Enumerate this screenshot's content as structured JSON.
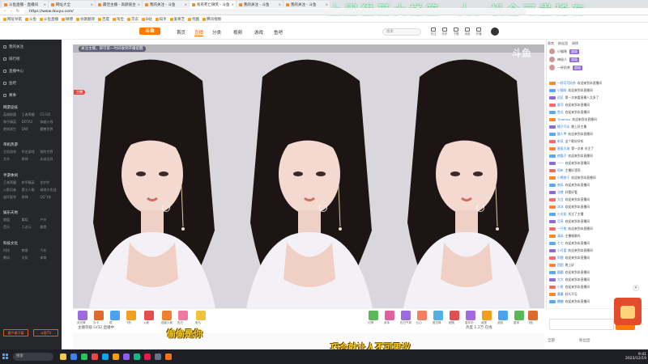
{
  "browser": {
    "tabs": [
      {
        "label": "斗鱼直播 - 直播间"
      },
      {
        "label": "网址大全"
      },
      {
        "label": "最佳主播 - 高颜值主播"
      },
      {
        "label": "我的关注 - 斗鱼"
      },
      {
        "label": "有有死亡微笑 - 斗鱼"
      },
      {
        "label": "我的关注 - 斗鱼"
      },
      {
        "label": "我的关注 - 斗鱼"
      }
    ],
    "url": "https://www.douyu.com/",
    "bookmarks": [
      "网址导航",
      "斗鱼",
      "斗鱼直播",
      "微博",
      "谷歌翻译",
      "百度",
      "淘宝",
      "京东",
      "B站",
      "知乎",
      "爱奇艺",
      "优酷",
      "腾讯视频"
    ]
  },
  "overlay_title": "上周猫耳大楼第一人，机会可贵稀有",
  "site": {
    "logo": "斗鱼",
    "nav": [
      {
        "label": "首页",
        "active": false
      },
      {
        "label": "直播",
        "active": true
      },
      {
        "label": "分类",
        "active": false
      },
      {
        "label": "视频",
        "active": false
      },
      {
        "label": "游戏",
        "active": false
      },
      {
        "label": "鱼吧",
        "active": false
      }
    ],
    "search_placeholder": "搜索",
    "header_icons": [
      "关注",
      "历史",
      "下载",
      "消息",
      "开播"
    ]
  },
  "sidebar": {
    "top_items": [
      "我的关注",
      "排行榜",
      "直播中心",
      "鱼吧",
      "赛事"
    ],
    "sections": [
      {
        "title": "网游竞技",
        "items": [
          "英雄联盟",
          "王者荣耀",
          "CS:GO",
          "和平精英",
          "DOTA2",
          "穿越火线",
          "绝地求生",
          "DNF",
          "魔兽世界"
        ]
      },
      {
        "title": "单机热游",
        "items": [
          "主机游戏",
          "怀旧游戏",
          "我的世界",
          "方舟",
          "原神",
          "永劫无间"
        ]
      },
      {
        "title": "手游休闲",
        "items": [
          "王者荣耀",
          "和平精英",
          "金铲铲",
          "火影忍者",
          "第五人格",
          "球球大作战",
          "崩坏星穹",
          "原神",
          "QQ飞车"
        ]
      },
      {
        "title": "娱乐天地",
        "items": [
          "颜值",
          "舞蹈",
          "户外",
          "音乐",
          "二次元",
          "美食"
        ]
      },
      {
        "title": "科技文化",
        "items": [
          "科技",
          "教育",
          "汽车",
          "数码",
          "文化",
          "体育"
        ]
      }
    ],
    "buttons": [
      "客户端下载",
      "斗鱼TV"
    ]
  },
  "player": {
    "notice": "关注主播，即可第一时间收到开播提醒",
    "watermark": "斗鱼",
    "tag": "主播",
    "subtitle_left": "偷偷是你",
    "subtitle_right": "巧合就让人不可思议"
  },
  "giftbar": {
    "gifts": [
      "荧光棒",
      "办卡",
      "稳",
      "飞机",
      "火箭",
      "超级火箭",
      "告白",
      "鱼丸",
      "灯牌",
      "亲亲",
      "告白气球",
      "比心",
      "魔法棒",
      "超跑",
      "嘉年华",
      "城堡",
      "游艇",
      "星球",
      "飞船"
    ],
    "room_meta": "主播等级 LV32 直播中",
    "room_meta2": "热度 1.2万  在线"
  },
  "chat": {
    "rank_tabs": [
      "贵宾",
      "粉丝团",
      "周榜"
    ],
    "rank": [
      {
        "name": "小猫咪",
        "badge": "超级"
      },
      {
        "name": "神秘人",
        "badge": "超级"
      },
      {
        "name": "一杯奶茶",
        "badge": "超级"
      }
    ],
    "messages": [
      {
        "badge_color": "#ff8a2b",
        "user": "一杯可可奶茶",
        "text": "欢迎来到本直播间"
      },
      {
        "badge_color": "#5aa9ff",
        "user": "小猫呀",
        "text": "欢迎来到本直播间"
      },
      {
        "badge_color": "#8e6ad6",
        "user": "初见",
        "text": "第一次来看直播人太多了"
      },
      {
        "badge_color": "#ff6a6a",
        "user": "星河",
        "text": "欢迎来到本直播间"
      },
      {
        "badge_color": "#5aa9ff",
        "user": "鱼丸",
        "text": "欢迎来到本直播间"
      },
      {
        "badge_color": "#ff8a2b",
        "user": "Tiramisu",
        "text": "欢迎来到本直播间"
      },
      {
        "badge_color": "#8e6ad6",
        "user": "橘子汽水",
        "text": "晚上好主播"
      },
      {
        "badge_color": "#5aa9ff",
        "user": "路人甲",
        "text": "欢迎来到本直播间"
      },
      {
        "badge_color": "#ff6a6a",
        "user": "听风",
        "text": "这个歌好好听"
      },
      {
        "badge_color": "#ff8a2b",
        "user": "星辰大海",
        "text": "第一次来 关注了"
      },
      {
        "badge_color": "#5aa9ff",
        "user": "夜猫子",
        "text": "欢迎来到本直播间"
      },
      {
        "badge_color": "#8e6ad6",
        "user": "一一",
        "text": "欢迎来到本直播间"
      },
      {
        "badge_color": "#ff6a6a",
        "user": "阿布",
        "text": "主播好漂亮"
      },
      {
        "badge_color": "#ff8a2b",
        "user": "小熊饼干",
        "text": "欢迎来到本直播间"
      },
      {
        "badge_color": "#5aa9ff",
        "user": "南风",
        "text": "欢迎来到本直播间"
      },
      {
        "badge_color": "#8e6ad6",
        "user": "北巷",
        "text": "好看好看"
      },
      {
        "badge_color": "#ff6a6a",
        "user": "大白",
        "text": "欢迎来到本直播间"
      },
      {
        "badge_color": "#ff8a2b",
        "user": "沐沐",
        "text": "欢迎来到本直播间"
      },
      {
        "badge_color": "#5aa9ff",
        "user": "小太阳",
        "text": "关注了主播"
      },
      {
        "badge_color": "#8e6ad6",
        "user": "月亮",
        "text": "欢迎来到本直播间"
      },
      {
        "badge_color": "#ff6a6a",
        "user": "一只鱼",
        "text": "欢迎来到本直播间"
      },
      {
        "badge_color": "#ff8a2b",
        "user": "清风",
        "text": "主播唱歌吗"
      },
      {
        "badge_color": "#5aa9ff",
        "user": "七七",
        "text": "欢迎来到本直播间"
      },
      {
        "badge_color": "#8e6ad6",
        "user": "小可爱",
        "text": "欢迎来到本直播间"
      },
      {
        "badge_color": "#ff6a6a",
        "user": "阿狸",
        "text": "欢迎来到本直播间"
      },
      {
        "badge_color": "#ff8a2b",
        "user": "团团",
        "text": "晚上好"
      },
      {
        "badge_color": "#5aa9ff",
        "user": "圆圆",
        "text": "欢迎来到本直播间"
      },
      {
        "badge_color": "#8e6ad6",
        "user": "大大",
        "text": "欢迎来到本直播间"
      },
      {
        "badge_color": "#ff6a6a",
        "user": "小鱼",
        "text": "欢迎来到本直播间"
      },
      {
        "badge_color": "#ff8a2b",
        "user": "墨墨",
        "text": "好久不见"
      },
      {
        "badge_color": "#5aa9ff",
        "user": "糖糖",
        "text": "欢迎来到本直播间"
      }
    ],
    "send_label": "发送",
    "bottom_tabs": [
      "全部",
      "粉丝团"
    ]
  },
  "taskbar": {
    "search_placeholder": "搜索",
    "time": "9:41",
    "date": "2023/12/19"
  }
}
